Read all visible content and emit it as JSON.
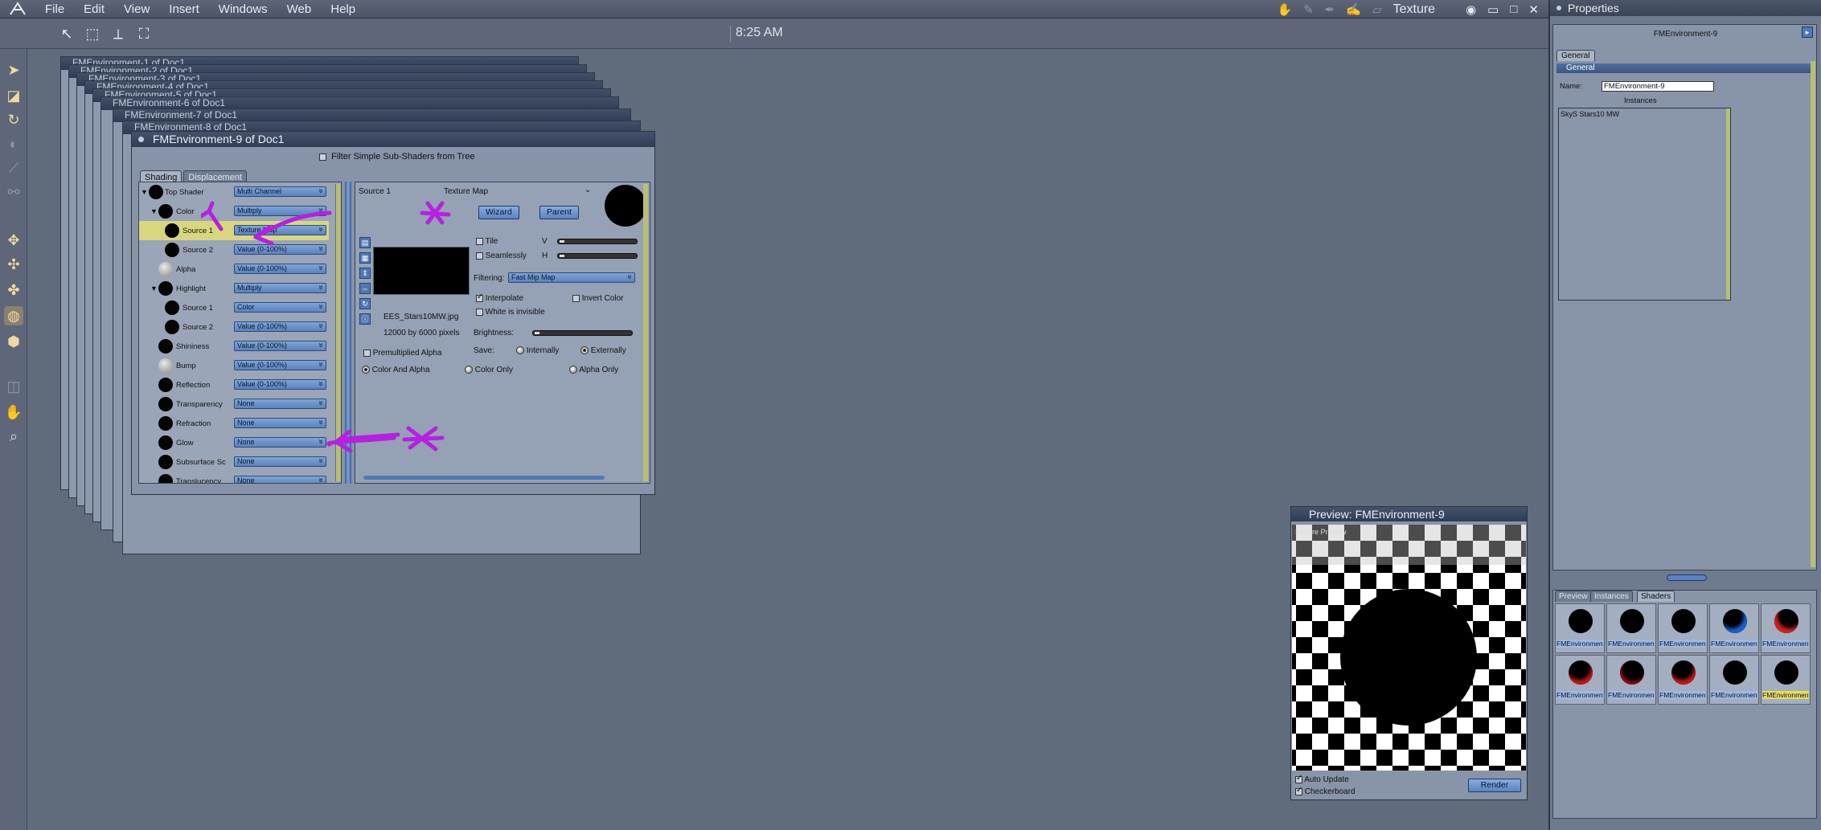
{
  "app": {
    "menu": [
      "File",
      "Edit",
      "View",
      "Insert",
      "Windows",
      "Web",
      "Help"
    ],
    "room": "Texture",
    "clock": "8:25 AM"
  },
  "shader_window": {
    "title": "FMEnvironment-9 of Doc1",
    "filter_label": "Filter Simple Sub-Shaders from Tree",
    "tabs": [
      "Shading",
      "Displacement"
    ],
    "tree": [
      {
        "label": "Top Shader",
        "value": "Multi Channel",
        "level": 0
      },
      {
        "label": "Color",
        "value": "Multiply",
        "level": 1
      },
      {
        "label": "Source 1",
        "value": "Texture Map",
        "level": 2,
        "selected": true
      },
      {
        "label": "Source 2",
        "value": "Value (0-100%)",
        "level": 2
      },
      {
        "label": "Alpha",
        "value": "Value (0-100%)",
        "level": 1
      },
      {
        "label": "Highlight",
        "value": "Multiply",
        "level": 1
      },
      {
        "label": "Source 1",
        "value": "Color",
        "level": 2
      },
      {
        "label": "Source 2",
        "value": "Value (0-100%)",
        "level": 2
      },
      {
        "label": "Shininess",
        "value": "Value (0-100%)",
        "level": 1
      },
      {
        "label": "Bump",
        "value": "Value (0-100%)",
        "level": 1
      },
      {
        "label": "Reflection",
        "value": "Value (0-100%)",
        "level": 1
      },
      {
        "label": "Transparency",
        "value": "None",
        "level": 1
      },
      {
        "label": "Refraction",
        "value": "None",
        "level": 1
      },
      {
        "label": "Glow",
        "value": "None",
        "level": 1
      },
      {
        "label": "Subsurface Sc",
        "value": "None",
        "level": 1
      },
      {
        "label": "Translucency",
        "value": "None",
        "level": 1
      }
    ],
    "detail": {
      "source_label": "Source 1",
      "type_label": "Texture Map",
      "wizard": "Wizard",
      "parent": "Parent",
      "tile": "Tile",
      "seamlessly": "Seamlessly",
      "v": "V",
      "h": "H",
      "filtering_label": "Filtering:",
      "filtering_value": "Fast Mip Map",
      "interpolate": "Interpolate",
      "invert_color": "Invert Color",
      "white_invisible": "White is invisible",
      "filename": "EES_Stars10MW.jpg",
      "dimensions": "12000 by 6000 pixels",
      "brightness": "Brightness:",
      "premultiplied": "Premultiplied Alpha",
      "save_label": "Save:",
      "internally": "Internally",
      "externally": "Externally",
      "color_and_alpha": "Color And Alpha",
      "color_only": "Color Only",
      "alpha_only": "Alpha Only"
    }
  },
  "stacked_titles": [
    "FMEnvironment-1 of Doc1",
    "FMEnvironment-2 of Doc1",
    "FMEnvironment-3 of Doc1",
    "FMEnvironment-4 of Doc1",
    "FMEnvironment-5 of Doc1",
    "FMEnvironment-6 of Doc1",
    "FMEnvironment-7 of Doc1",
    "FMEnvironment-8 of Doc1"
  ],
  "properties": {
    "title": "Properties",
    "object_name": "FMEnvironment-9",
    "tab": "General",
    "section": "General",
    "name_label": "Name:",
    "name_value": "FMEnvironment-9",
    "instances_label": "Instances",
    "instances": [
      "SkyS Stars10 MW"
    ],
    "lower_tabs": [
      "Preview",
      "Instances",
      "Shaders"
    ],
    "shaders": [
      "FMEnvironment",
      "FMEnvironment",
      "FMEnvironment",
      "FMEnvironment",
      "FMEnvironment",
      "FMEnvironment",
      "FMEnvironment",
      "FMEnvironment",
      "FMEnvironment",
      "FMEnvironment"
    ]
  },
  "preview": {
    "title": "Preview: FMEnvironment-9",
    "overlay": "Sphere Preview",
    "auto_update": "Auto Update",
    "checkerboard": "Checkerboard",
    "render": "Render"
  }
}
